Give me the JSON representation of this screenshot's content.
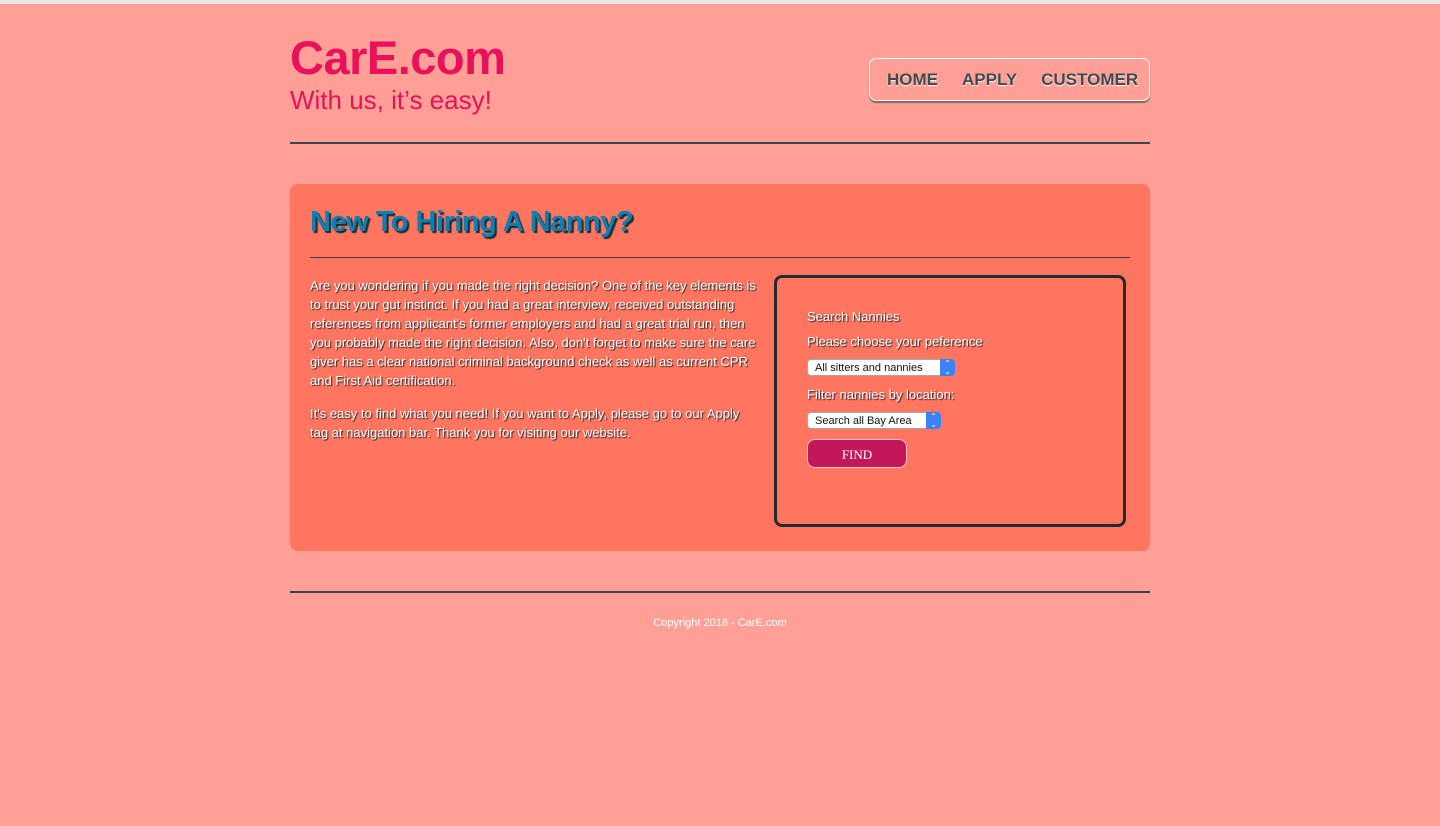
{
  "header": {
    "logo": "CarE.com",
    "tagline": "With us, it’s easy!"
  },
  "nav": {
    "items": [
      "HOME",
      "APPLY",
      "CUSTOMER"
    ]
  },
  "main": {
    "title": "New To Hiring A Nanny?",
    "paragraphs": [
      "Are you wondering if you made the right decision? One of the key elements is to trust your gut instinct. If you had a great interview, received outstanding references from applicant's former employers and had a great trial run, then you probably made the right decision. Also, don't forget to make sure the care giver has a clear national criminal background check as well as current CPR and First Aid certification.",
      "It's easy to find what you need! If you want to Apply, please go to our Apply tag at navigation bar. Thank you for visiting our website."
    ]
  },
  "search": {
    "heading": "Search Nannies",
    "preference_label": "Please choose your peference",
    "preference_selected": "All sitters and nannies",
    "location_label": "Filter nannies by location:",
    "location_selected": "Search all Bay Area",
    "find_label": "FIND"
  },
  "footer": {
    "copyright": "Copyright 2018 - CarE.com"
  },
  "colors": {
    "page_background": "#ff9f96",
    "panel_background": "#ff7560",
    "brand": "#e8115a",
    "title": "#0d7fb0",
    "button": "#c2185b",
    "select_arrow": "#3b82f6"
  },
  "icons": {
    "select_arrow": "updown-chevron-icon"
  }
}
